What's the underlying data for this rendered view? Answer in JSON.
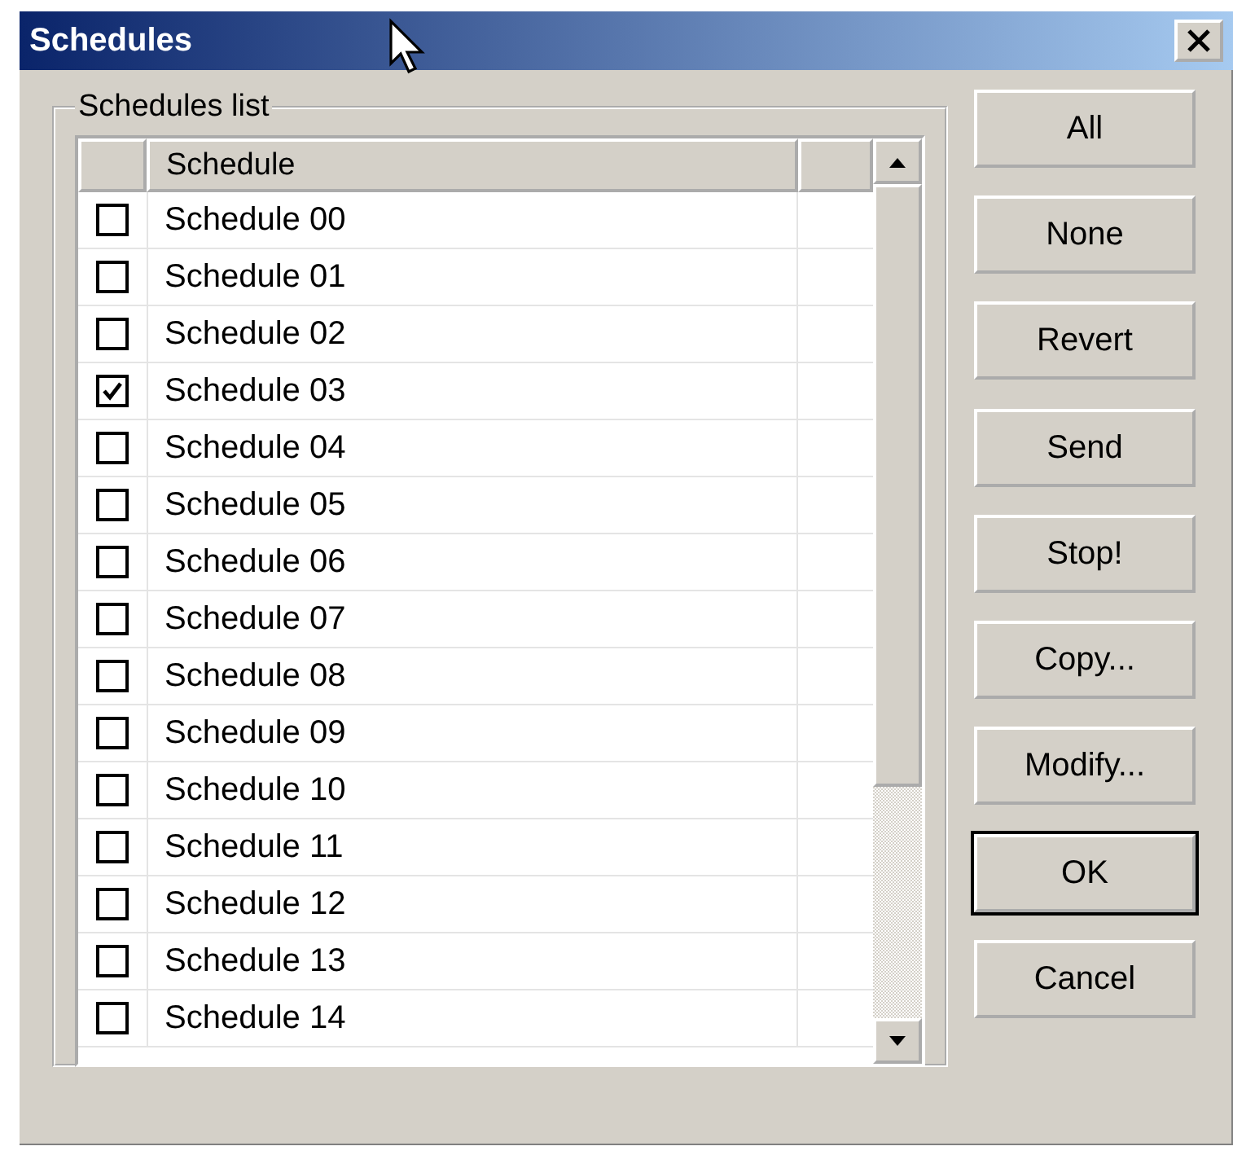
{
  "window": {
    "title": "Schedules"
  },
  "group": {
    "label": "Schedules list"
  },
  "table": {
    "heading": "Schedule",
    "rows": [
      {
        "name": "Schedule 00",
        "checked": false
      },
      {
        "name": "Schedule 01",
        "checked": false
      },
      {
        "name": "Schedule 02",
        "checked": false
      },
      {
        "name": "Schedule 03",
        "checked": true
      },
      {
        "name": "Schedule 04",
        "checked": false
      },
      {
        "name": "Schedule 05",
        "checked": false
      },
      {
        "name": "Schedule 06",
        "checked": false
      },
      {
        "name": "Schedule 07",
        "checked": false
      },
      {
        "name": "Schedule 08",
        "checked": false
      },
      {
        "name": "Schedule 09",
        "checked": false
      },
      {
        "name": "Schedule 10",
        "checked": false
      },
      {
        "name": "Schedule 11",
        "checked": false
      },
      {
        "name": "Schedule 12",
        "checked": false
      },
      {
        "name": "Schedule 13",
        "checked": false
      },
      {
        "name": "Schedule 14",
        "checked": false
      }
    ]
  },
  "button_groups": [
    [
      {
        "label": "All",
        "default": false
      },
      {
        "label": "None",
        "default": false
      },
      {
        "label": "Revert",
        "default": false
      }
    ],
    [
      {
        "label": "Send",
        "default": false
      },
      {
        "label": "Stop!",
        "default": false
      },
      {
        "label": "Copy...",
        "default": false
      },
      {
        "label": "Modify...",
        "default": false
      }
    ],
    [
      {
        "label": "OK",
        "default": true
      },
      {
        "label": "Cancel",
        "default": false
      }
    ]
  ]
}
